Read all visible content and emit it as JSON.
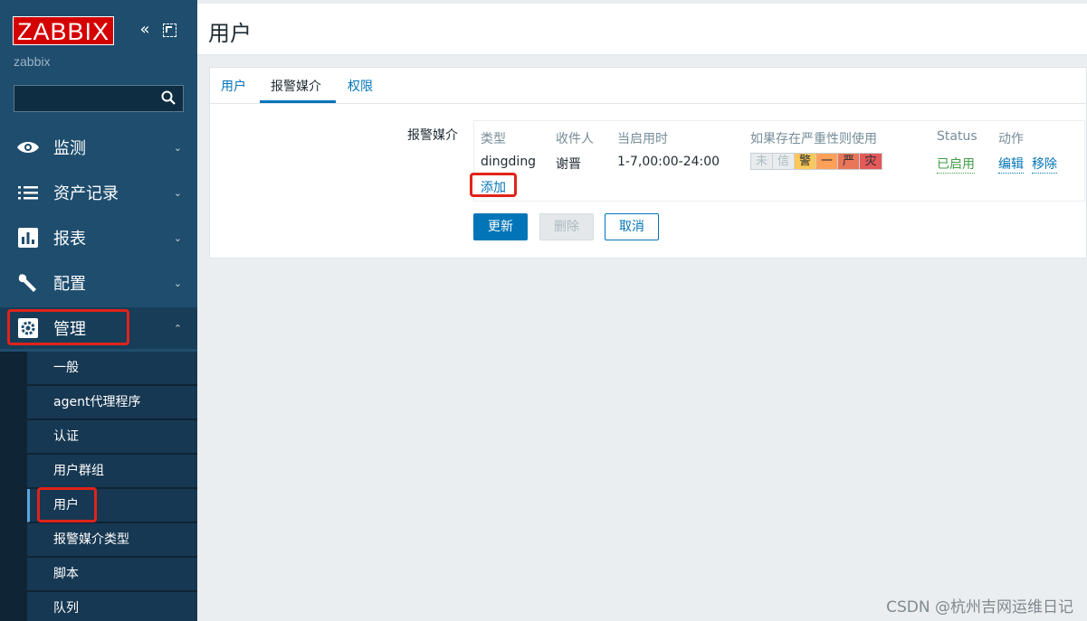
{
  "app": {
    "logo": "ZABBIX",
    "server_name": "zabbix",
    "collapse_glyph": "«",
    "search_placeholder": ""
  },
  "sidebar": {
    "menu": [
      {
        "label": "监测",
        "icon": "eye-icon",
        "chevron": "⌄"
      },
      {
        "label": "资产记录",
        "icon": "list-icon",
        "chevron": "⌄"
      },
      {
        "label": "报表",
        "icon": "bar-chart-icon",
        "chevron": "⌄"
      },
      {
        "label": "配置",
        "icon": "wrench-icon",
        "chevron": "⌄"
      },
      {
        "label": "管理",
        "icon": "gear-icon",
        "chevron": "⌃"
      }
    ],
    "submenu": [
      "一般",
      "agent代理程序",
      "认证",
      "用户群组",
      "用户",
      "报警媒介类型",
      "脚本",
      "队列"
    ]
  },
  "page": {
    "title": "用户",
    "tabs": [
      "用户",
      "报警媒介",
      "权限"
    ],
    "active_tab": "报警媒介"
  },
  "media": {
    "field_label": "报警媒介",
    "headers": [
      "类型",
      "收件人",
      "当启用时",
      "如果存在严重性则使用",
      "Status",
      "动作"
    ],
    "row": {
      "type": "dingding",
      "recipient": "谢晋",
      "when_active": "1-7,00:00-24:00",
      "severities": [
        {
          "label": "未",
          "color": "#e8ecee",
          "text": "#acbbc2"
        },
        {
          "label": "信",
          "color": "#e8ecee",
          "text": "#acbbc2"
        },
        {
          "label": "警",
          "color": "#ffc859",
          "text": "#1f2c33"
        },
        {
          "label": "一",
          "color": "#ffa059",
          "text": "#1f2c33"
        },
        {
          "label": "严",
          "color": "#e97659",
          "text": "#1f2c33"
        },
        {
          "label": "灾",
          "color": "#e45959",
          "text": "#1f2c33"
        }
      ],
      "status": "已启用",
      "action_edit": "编辑",
      "action_remove": "移除"
    },
    "add_link": "添加"
  },
  "buttons": {
    "update": "更新",
    "delete": "删除",
    "cancel": "取消"
  },
  "watermark": "CSDN @杭州吉网运维日记"
}
